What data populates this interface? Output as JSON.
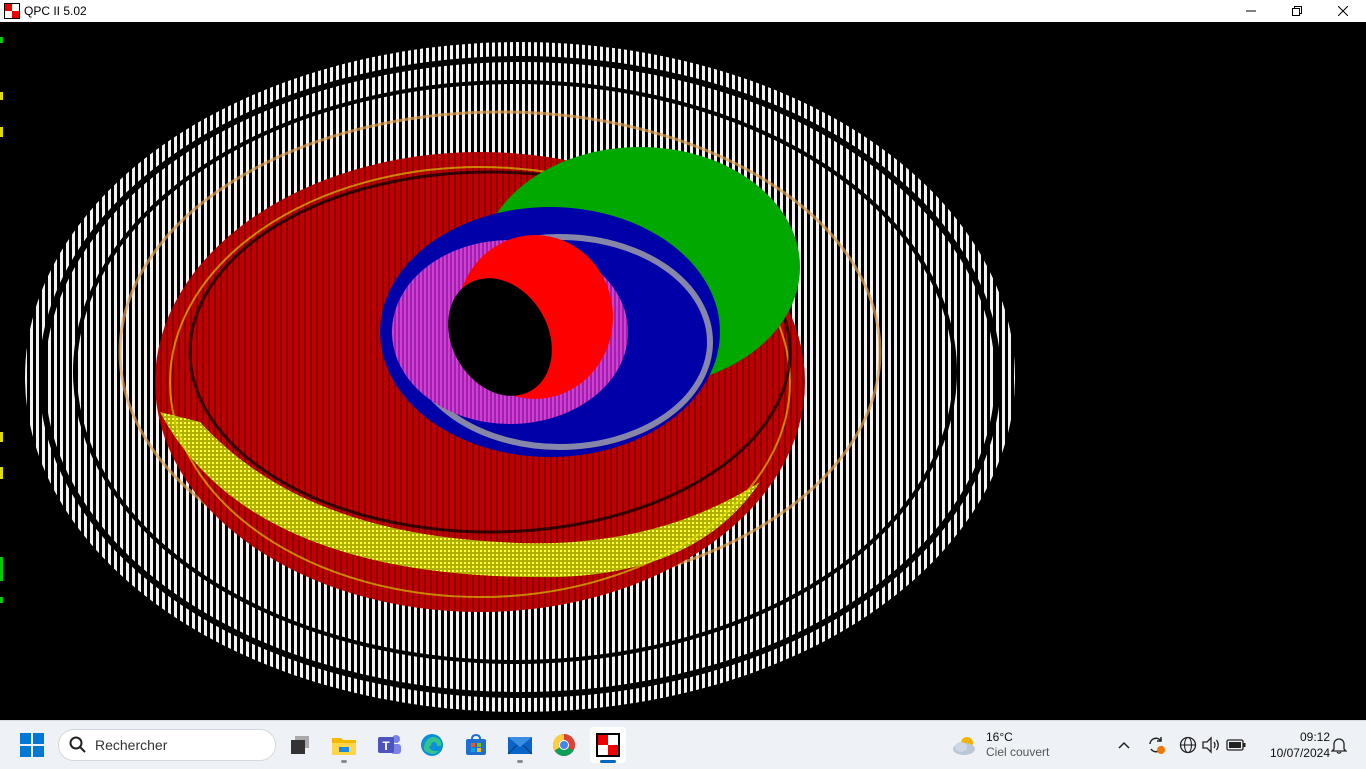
{
  "window": {
    "title": "QPC II 5.02"
  },
  "window_controls": [
    "minimize",
    "restore",
    "close"
  ],
  "emulator": {
    "content": "psychedelic-vortex-graphics"
  },
  "taskbar": {
    "search_placeholder": "Rechercher",
    "apps": [
      {
        "name": "task-view"
      },
      {
        "name": "file-explorer"
      },
      {
        "name": "teams"
      },
      {
        "name": "edge"
      },
      {
        "name": "microsoft-store"
      },
      {
        "name": "mail"
      },
      {
        "name": "chrome"
      },
      {
        "name": "qpc"
      }
    ],
    "weather": {
      "temp": "16°C",
      "desc": "Ciel couvert"
    },
    "clock": {
      "time": "09:12",
      "date": "10/07/2024"
    }
  },
  "colors": {
    "accent": "#0067c0",
    "emu_bg": "#000000",
    "taskbar_bg": "#eef2f7"
  }
}
